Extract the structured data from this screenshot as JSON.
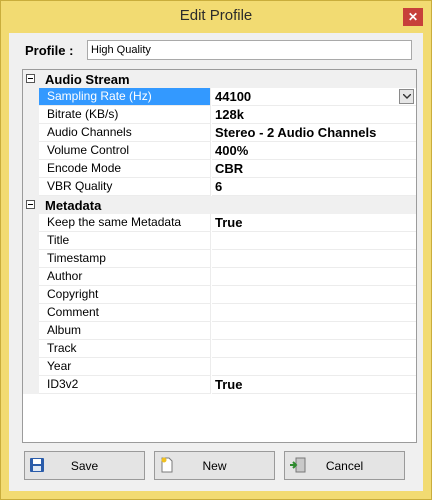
{
  "window": {
    "title": "Edit Profile",
    "close_icon": "close-icon"
  },
  "profile": {
    "label": "Profile :",
    "value": "High Quality"
  },
  "grid": {
    "categories": [
      {
        "label": "Audio Stream",
        "rows": [
          {
            "name": "Sampling Rate (Hz)",
            "value": "44100",
            "selected": true,
            "dropdown": true
          },
          {
            "name": "Bitrate (KB/s)",
            "value": "128k"
          },
          {
            "name": "Audio Channels",
            "value": "Stereo - 2 Audio Channels"
          },
          {
            "name": "Volume Control",
            "value": "400%"
          },
          {
            "name": "Encode Mode",
            "value": "CBR"
          },
          {
            "name": "VBR Quality",
            "value": "6"
          }
        ]
      },
      {
        "label": "Metadata",
        "rows": [
          {
            "name": "Keep the same Metadata",
            "value": "True"
          },
          {
            "name": "Title",
            "value": ""
          },
          {
            "name": "Timestamp",
            "value": ""
          },
          {
            "name": "Author",
            "value": ""
          },
          {
            "name": "Copyright",
            "value": ""
          },
          {
            "name": "Comment",
            "value": ""
          },
          {
            "name": "Album",
            "value": ""
          },
          {
            "name": "Track",
            "value": ""
          },
          {
            "name": "Year",
            "value": ""
          },
          {
            "name": "ID3v2",
            "value": "True"
          }
        ]
      }
    ]
  },
  "buttons": {
    "save": {
      "label": "Save",
      "icon": "floppy-disk-icon"
    },
    "new": {
      "label": "New",
      "icon": "new-document-icon"
    },
    "cancel": {
      "label": "Cancel",
      "icon": "exit-door-icon"
    }
  },
  "colors": {
    "titlebar": "#f2db72",
    "selection": "#3399ff",
    "close": "#c7403a"
  }
}
